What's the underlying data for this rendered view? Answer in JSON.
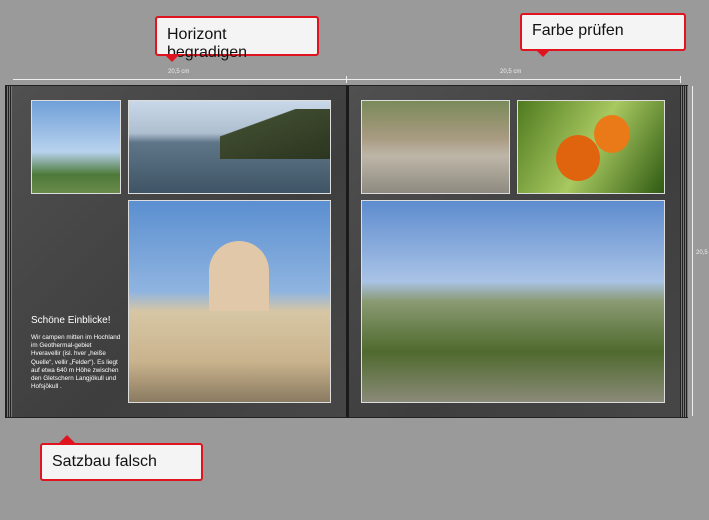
{
  "dimensions": {
    "left_width": "20,5 cm",
    "right_width": "20,5 cm",
    "height": "20,5"
  },
  "left_page": {
    "heading": "Schöne Einblicke!",
    "body": "Wir campen mitten im Hochland im Geothermal-gebiet Hveravellir (isl. hver „heiße Quelle“, vellir „Felder“). Es liegt auf etwa 640 m Höhe zwischen den Gletschern Langjökull und Hofsjökull ."
  },
  "callouts": {
    "horizon": "Horizont begradigen",
    "color": "Farbe prüfen",
    "syntax": "Satzbau falsch"
  },
  "colors": {
    "callout_border": "#e0141e"
  }
}
